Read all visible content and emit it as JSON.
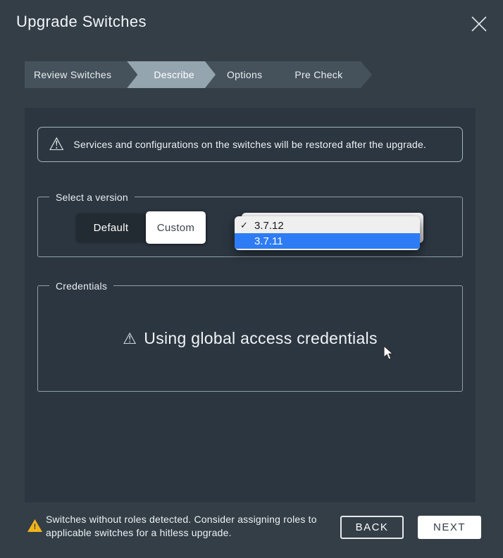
{
  "colors": {
    "modal_bg": "#333e47",
    "panel_bg": "#2c3640",
    "stepper_bar": "#46525b",
    "stepper_active": "#95a5b0",
    "highlight_blue": "#2e7bf6",
    "warning_yellow": "#f1b51b",
    "border_light": "#a6b4bc"
  },
  "header": {
    "title": "Upgrade Switches"
  },
  "stepper": {
    "steps": [
      {
        "label": "Review Switches",
        "active": false
      },
      {
        "label": "Describe",
        "active": true
      },
      {
        "label": "Options",
        "active": false
      },
      {
        "label": "Pre Check",
        "active": false
      }
    ]
  },
  "notice": {
    "icon_glyph": "⚠",
    "text": "Services and configurations on the switches will be restored after the upgrade."
  },
  "version_section": {
    "label": "Select a version",
    "toggle": {
      "options": {
        "0": "Default",
        "1": "Custom"
      },
      "selected": "Custom"
    },
    "dropdown": {
      "check_glyph": "✓",
      "options": [
        {
          "label": "3.7.12",
          "checked": true,
          "highlighted": false
        },
        {
          "label": "3.7.11",
          "checked": false,
          "highlighted": true
        }
      ]
    }
  },
  "credentials_section": {
    "label": "Credentials",
    "icon_glyph": "⚠",
    "message": "Using global access credentials"
  },
  "footer": {
    "warning_glyph": "!",
    "warning_text": "Switches without roles detected. Consider assigning roles to applicable switches for a hitless upgrade.",
    "back_label": "BACK",
    "next_label": "NEXT"
  }
}
